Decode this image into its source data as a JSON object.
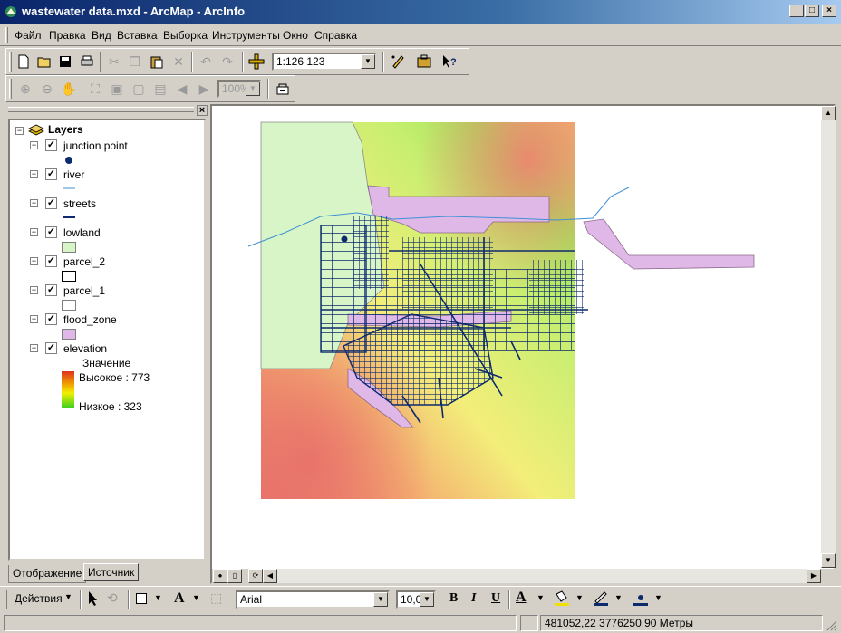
{
  "window": {
    "title": "wastewater data.mxd - ArcMap - ArcInfo",
    "minimize": "_",
    "maximize": "□",
    "close": "×"
  },
  "menu": [
    "Файл",
    "Правка",
    "Вид",
    "Вставка",
    "Выборка",
    "Инструменты",
    "Окно",
    "Справка"
  ],
  "toolbar": {
    "scale": "1:126 123",
    "zoom_percent": "100%"
  },
  "toc": {
    "root": "Layers",
    "layers": [
      {
        "name": "junction point",
        "checked": true,
        "symbol": "point"
      },
      {
        "name": "river",
        "checked": true,
        "symbol": "line-river"
      },
      {
        "name": "streets",
        "checked": true,
        "symbol": "line-street"
      },
      {
        "name": "lowland",
        "checked": true,
        "symbol": "fill-lowland"
      },
      {
        "name": "parcel_2",
        "checked": true,
        "symbol": "fill-white"
      },
      {
        "name": "parcel_1",
        "checked": true,
        "symbol": "fill-white"
      },
      {
        "name": "flood_zone",
        "checked": true,
        "symbol": "fill-flood"
      },
      {
        "name": "elevation",
        "checked": true,
        "symbol": "ramp"
      }
    ],
    "elevation_legend": {
      "heading": "Значение",
      "high": "Высокое : 773",
      "low": "Низкое : 323"
    },
    "tabs": [
      "Отображение",
      "Источник"
    ]
  },
  "drawbar": {
    "drawing_label": "Действия",
    "font": "Arial",
    "font_size": "10,0",
    "bold": "B",
    "italic": "I",
    "underline": "U",
    "text_tool": "A",
    "font_color_letter": "A"
  },
  "status": {
    "coords": "481052,22  3776250,90 Метры"
  },
  "colors": {
    "titlebar": "#0a246a",
    "streets": "#0d2a6e",
    "river": "#3f8fd6",
    "lowland": "#d8f5c8",
    "flood_zone": "#e0b8e8",
    "elev_high": "#e8736a",
    "elev_low": "#8be04e"
  }
}
